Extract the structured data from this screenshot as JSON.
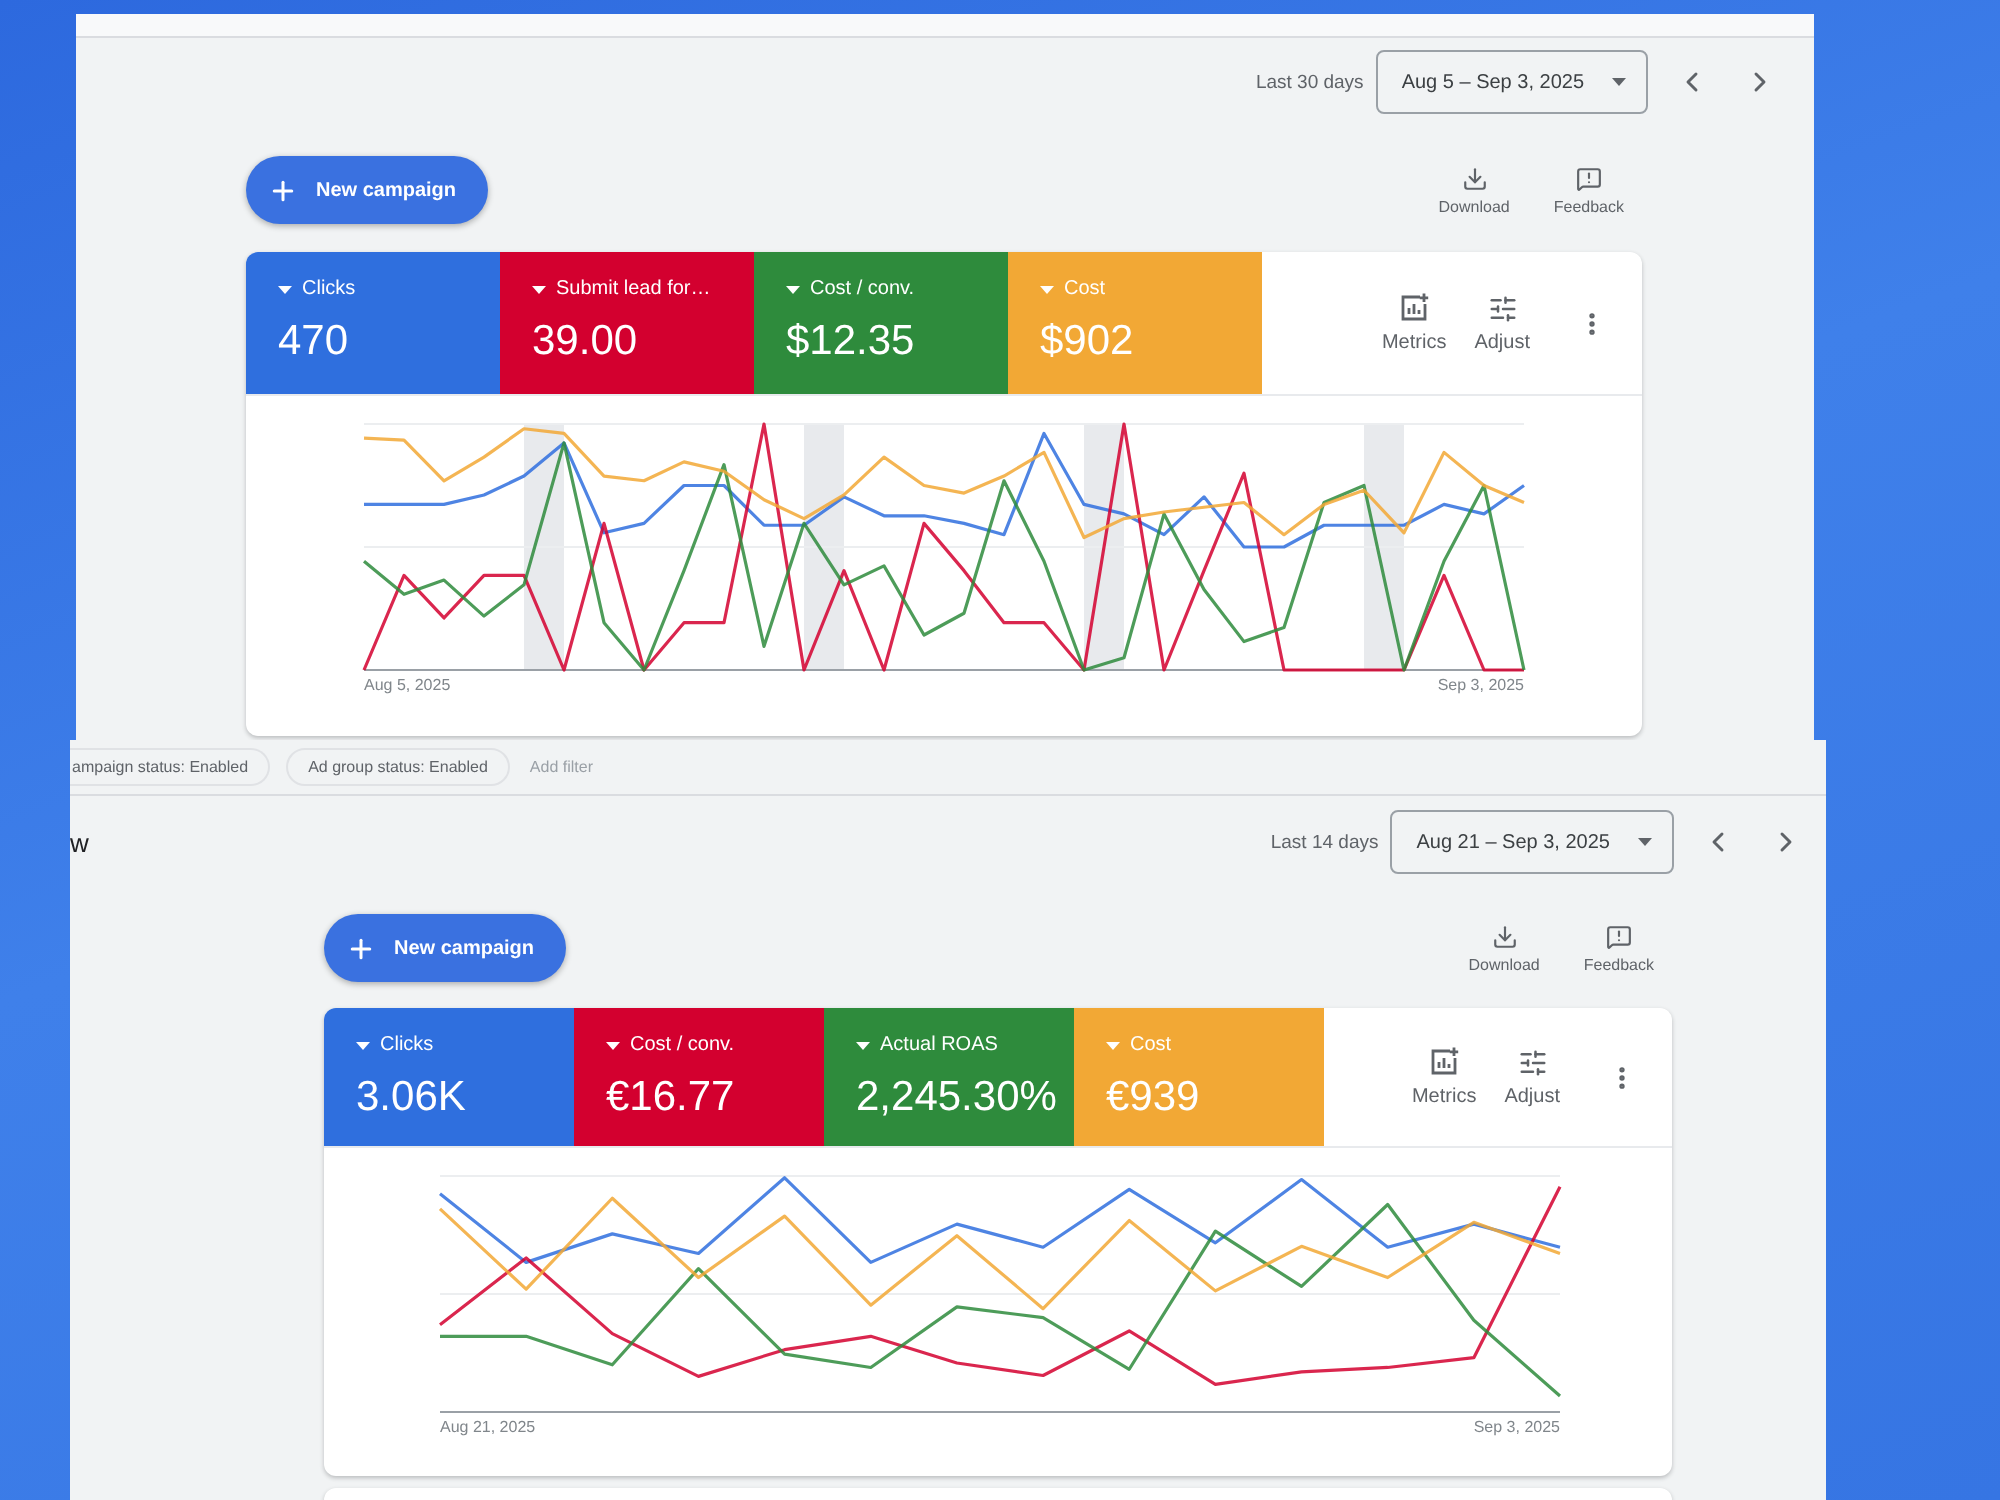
{
  "panels": [
    {
      "range_label": "Last 30 days",
      "date_range": "Aug 5 – Sep 3, 2025",
      "new_campaign": "New campaign",
      "actions": [
        {
          "kind": "download",
          "label": "Download"
        },
        {
          "kind": "feedback",
          "label": "Feedback"
        }
      ],
      "metrics": [
        {
          "label": "Clicks",
          "value": "470",
          "color": "#2f6fde"
        },
        {
          "label": "Submit lead for…",
          "value": "39.00",
          "color": "#d3002f"
        },
        {
          "label": "Cost / conv.",
          "value": "$12.35",
          "color": "#2e8b3c"
        },
        {
          "label": "Cost",
          "value": "$902",
          "color": "#f2a835"
        }
      ],
      "tools": [
        {
          "kind": "metrics",
          "label": "Metrics"
        },
        {
          "kind": "adjust",
          "label": "Adjust"
        }
      ],
      "chart": {
        "start_label": "Aug 5, 2025",
        "end_label": "Sep 3, 2025"
      }
    },
    {
      "filters": [
        {
          "kind": "chip",
          "label": "ampaign status: Enabled"
        },
        {
          "kind": "chip",
          "label": "Ad group status: Enabled"
        },
        {
          "kind": "link",
          "label": "Add filter"
        }
      ],
      "heading": "w",
      "range_label": "Last 14 days",
      "date_range": "Aug 21 – Sep 3, 2025",
      "new_campaign": "New campaign",
      "actions": [
        {
          "kind": "download",
          "label": "Download"
        },
        {
          "kind": "feedback",
          "label": "Feedback"
        }
      ],
      "metrics": [
        {
          "label": "Clicks",
          "value": "3.06K",
          "color": "#2f6fde"
        },
        {
          "label": "Cost / conv.",
          "value": "€16.77",
          "color": "#d3002f"
        },
        {
          "label": "Actual ROAS",
          "value": "2,245.30%",
          "color": "#2e8b3c"
        },
        {
          "label": "Cost",
          "value": "€939",
          "color": "#f2a835"
        }
      ],
      "tools": [
        {
          "kind": "metrics",
          "label": "Metrics"
        },
        {
          "kind": "adjust",
          "label": "Adjust"
        }
      ],
      "chart": {
        "start_label": "Aug 21, 2025",
        "end_label": "Sep 3, 2025"
      }
    }
  ]
}
